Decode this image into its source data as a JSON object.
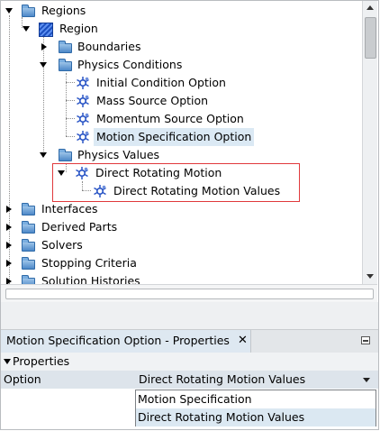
{
  "tree": {
    "nodes": [
      {
        "label": "Regions",
        "icon": "folder-icon"
      },
      {
        "label": "Region",
        "icon": "region-icon"
      },
      {
        "label": "Boundaries",
        "icon": "folder-icon"
      },
      {
        "label": "Physics Conditions",
        "icon": "folder-icon"
      },
      {
        "label": "Initial Condition Option",
        "icon": "physics-node-icon"
      },
      {
        "label": "Mass Source Option",
        "icon": "physics-node-icon"
      },
      {
        "label": "Momentum Source Option",
        "icon": "physics-node-icon"
      },
      {
        "label": "Motion Specification Option",
        "icon": "physics-node-icon",
        "selected": true
      },
      {
        "label": "Physics Values",
        "icon": "folder-icon"
      },
      {
        "label": "Direct Rotating Motion",
        "icon": "physics-node-icon"
      },
      {
        "label": "Direct Rotating Motion Values",
        "icon": "physics-node-icon"
      },
      {
        "label": "Interfaces",
        "icon": "folder-icon"
      },
      {
        "label": "Derived Parts",
        "icon": "folder-icon"
      },
      {
        "label": "Solvers",
        "icon": "folder-icon"
      },
      {
        "label": "Stopping Criteria",
        "icon": "folder-icon"
      },
      {
        "label": "Solution Histories",
        "icon": "folder-icon"
      }
    ]
  },
  "properties": {
    "tab_title": "Motion Specification Option - Properties",
    "close_glyph": "✕",
    "section_label": "Properties",
    "option_label": "Option",
    "option_value": "Direct Rotating Motion Values",
    "options": [
      {
        "label": "Motion Specification",
        "selected": false
      },
      {
        "label": "Direct Rotating Motion Values",
        "selected": true
      }
    ]
  },
  "colors": {
    "highlight": "#dbe9f4",
    "annotation_box": "#e0393c",
    "folder": "#4d88c8"
  }
}
